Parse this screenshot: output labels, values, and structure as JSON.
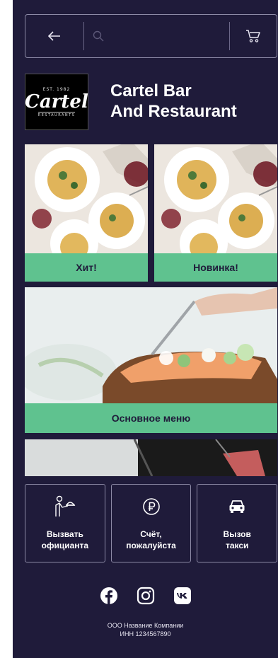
{
  "header": {
    "back_icon": "arrow-left-icon",
    "search_icon": "search-icon",
    "search_placeholder": "",
    "cart_icon": "cart-icon"
  },
  "brand": {
    "logo": {
      "top_text": "EST. 1982",
      "main_text": "Cartel",
      "bottom_text": "RESTAURANTS"
    },
    "name_line1": "Cartel Bar",
    "name_line2": "And Restaurant"
  },
  "menu_cards": [
    {
      "label": "Хит!"
    },
    {
      "label": "Новинка!"
    },
    {
      "label": "Основное меню"
    }
  ],
  "actions": [
    {
      "icon": "waiter-icon",
      "label": "Вызвать\nофицианта"
    },
    {
      "icon": "ruble-icon",
      "label": "Счёт,\nпожалуйста"
    },
    {
      "icon": "car-icon",
      "label": "Вызов\nтакси"
    }
  ],
  "socials": [
    {
      "icon": "facebook-icon"
    },
    {
      "icon": "instagram-icon"
    },
    {
      "icon": "vk-icon"
    }
  ],
  "footer": {
    "company": "ООО Название Компании",
    "inn": "ИНН 1234567890"
  },
  "colors": {
    "background": "#1f1b3a",
    "accent_green": "#5fc28f",
    "border": "#8d8aa6"
  }
}
